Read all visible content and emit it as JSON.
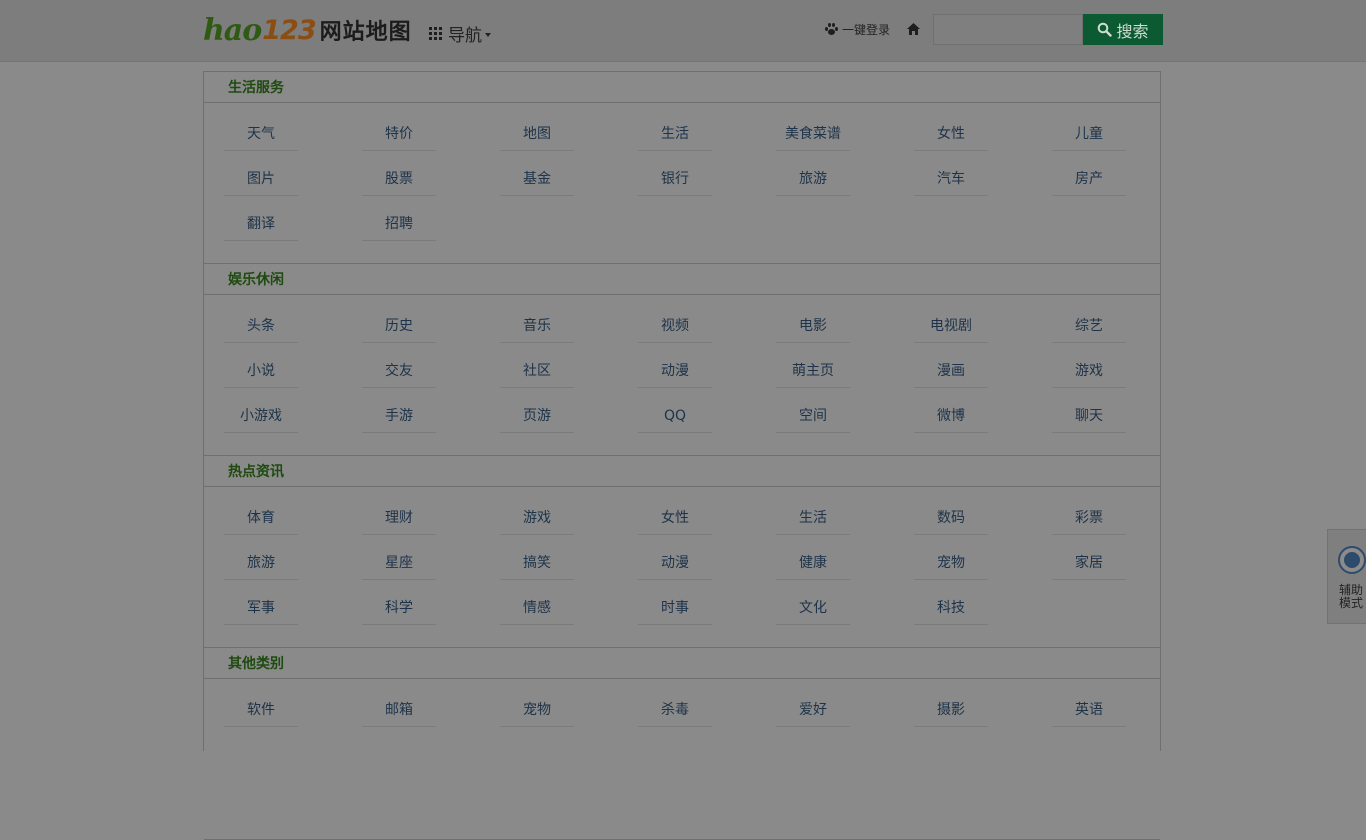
{
  "header": {
    "logo_hao": "hao",
    "logo_num": "123",
    "logo_title": "网站地图",
    "nav_label": "导航",
    "login_label": "一键登录",
    "search_placeholder": "",
    "search_button_label": "搜索"
  },
  "assist": {
    "label": "辅助模式"
  },
  "colors": {
    "search_button": "#0b5a32",
    "section_title": "#1f4a10",
    "link": "#1e3349",
    "overlay_bg": "#8a8a8a"
  },
  "sections": [
    {
      "title": "生活服务",
      "links": [
        "天气",
        "特价",
        "地图",
        "生活",
        "美食菜谱",
        "女性",
        "儿童",
        "图片",
        "股票",
        "基金",
        "银行",
        "旅游",
        "汽车",
        "房产",
        "翻译",
        "招聘"
      ]
    },
    {
      "title": "娱乐休闲",
      "links": [
        "头条",
        "历史",
        "音乐",
        "视频",
        "电影",
        "电视剧",
        "综艺",
        "小说",
        "交友",
        "社区",
        "动漫",
        "萌主页",
        "漫画",
        "游戏",
        "小游戏",
        "手游",
        "页游",
        "QQ",
        "空间",
        "微博",
        "聊天"
      ]
    },
    {
      "title": "热点资讯",
      "links": [
        "体育",
        "理财",
        "游戏",
        "女性",
        "生活",
        "数码",
        "彩票",
        "旅游",
        "星座",
        "搞笑",
        "动漫",
        "健康",
        "宠物",
        "家居",
        "军事",
        "科学",
        "情感",
        "时事",
        "文化",
        "科技"
      ]
    },
    {
      "title": "其他类别",
      "links": [
        "软件",
        "邮箱",
        "宠物",
        "杀毒",
        "爱好",
        "摄影",
        "英语"
      ]
    }
  ]
}
